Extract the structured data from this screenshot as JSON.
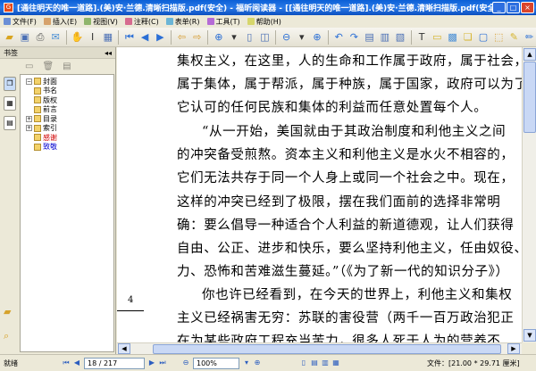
{
  "window": {
    "title": "[通往明天的唯一道路].(美)安·兰德.清晰扫描版.pdf(安全) - 福昕阅读器 - [[通往明天的唯一道路].(美)安·兰德.清晰扫描版.pdf(安全)]",
    "min": "_",
    "max": "□",
    "close": "×"
  },
  "menu": [
    {
      "label": "文件(F)",
      "color": "#6b8fd6"
    },
    {
      "label": "插入(E)",
      "color": "#d6a26b"
    },
    {
      "label": "视图(V)",
      "color": "#8fb56b"
    },
    {
      "label": "注释(C)",
      "color": "#d66b8f"
    },
    {
      "label": "表单(R)",
      "color": "#6bb5d6"
    },
    {
      "label": "工具(T)",
      "color": "#b56bd6"
    },
    {
      "label": "帮助(H)",
      "color": "#d6d66b"
    }
  ],
  "sidebar": {
    "header": "书签",
    "collapse": "◂◂",
    "items": [
      {
        "label": "封面",
        "color": "#000"
      },
      {
        "label": "书名",
        "color": "#000"
      },
      {
        "label": "版权",
        "color": "#000"
      },
      {
        "label": "前言",
        "color": "#000"
      },
      {
        "label": "目录",
        "color": "#000"
      },
      {
        "label": "索引",
        "color": "#000"
      },
      {
        "label": "感谢",
        "color": "#d00000"
      },
      {
        "label": "致敬",
        "color": "#0000d0"
      }
    ]
  },
  "page": {
    "number": "4",
    "lines": [
      "集权主义，在这里，人的生命和工作属于政府，属于社会，",
      "属于集体，属于帮派，属于种族，属于国家，政府可以为了",
      "它认可的任何民族和集体的利益而任意处置每个人。",
      "“从一开始，美国就由于其政治制度和利他主义之间",
      "的冲突备受煎熬。资本主义和利他主义是水火不相容的，",
      "它们无法共存于同一个人身上或同一个社会之中。现在，",
      "这样的冲突已经到了极限，摆在我们面前的选择非常明",
      "确：要么倡导一种适合个人利益的新道德观，让人们获得",
      "自由、公正、进步和快乐，要么坚持利他主义，任由奴役、暴",
      "力、恐怖和苦难滋生蔓延。”（《为了新一代的知识分子》）",
      "你也许已经看到，在今天的世界上，利他主义和集权",
      "主义已经祸害无穷：苏联的害役营（两千一百万政治犯正",
      "在为某些政府工程充当苦力，很多人死于人为的营养不"
    ]
  },
  "status": {
    "ready": "就绪",
    "page_indicator": "18 / 217",
    "zoom": "100%",
    "doc_size": "文件：[21.00 * 29.71 厘米]"
  }
}
